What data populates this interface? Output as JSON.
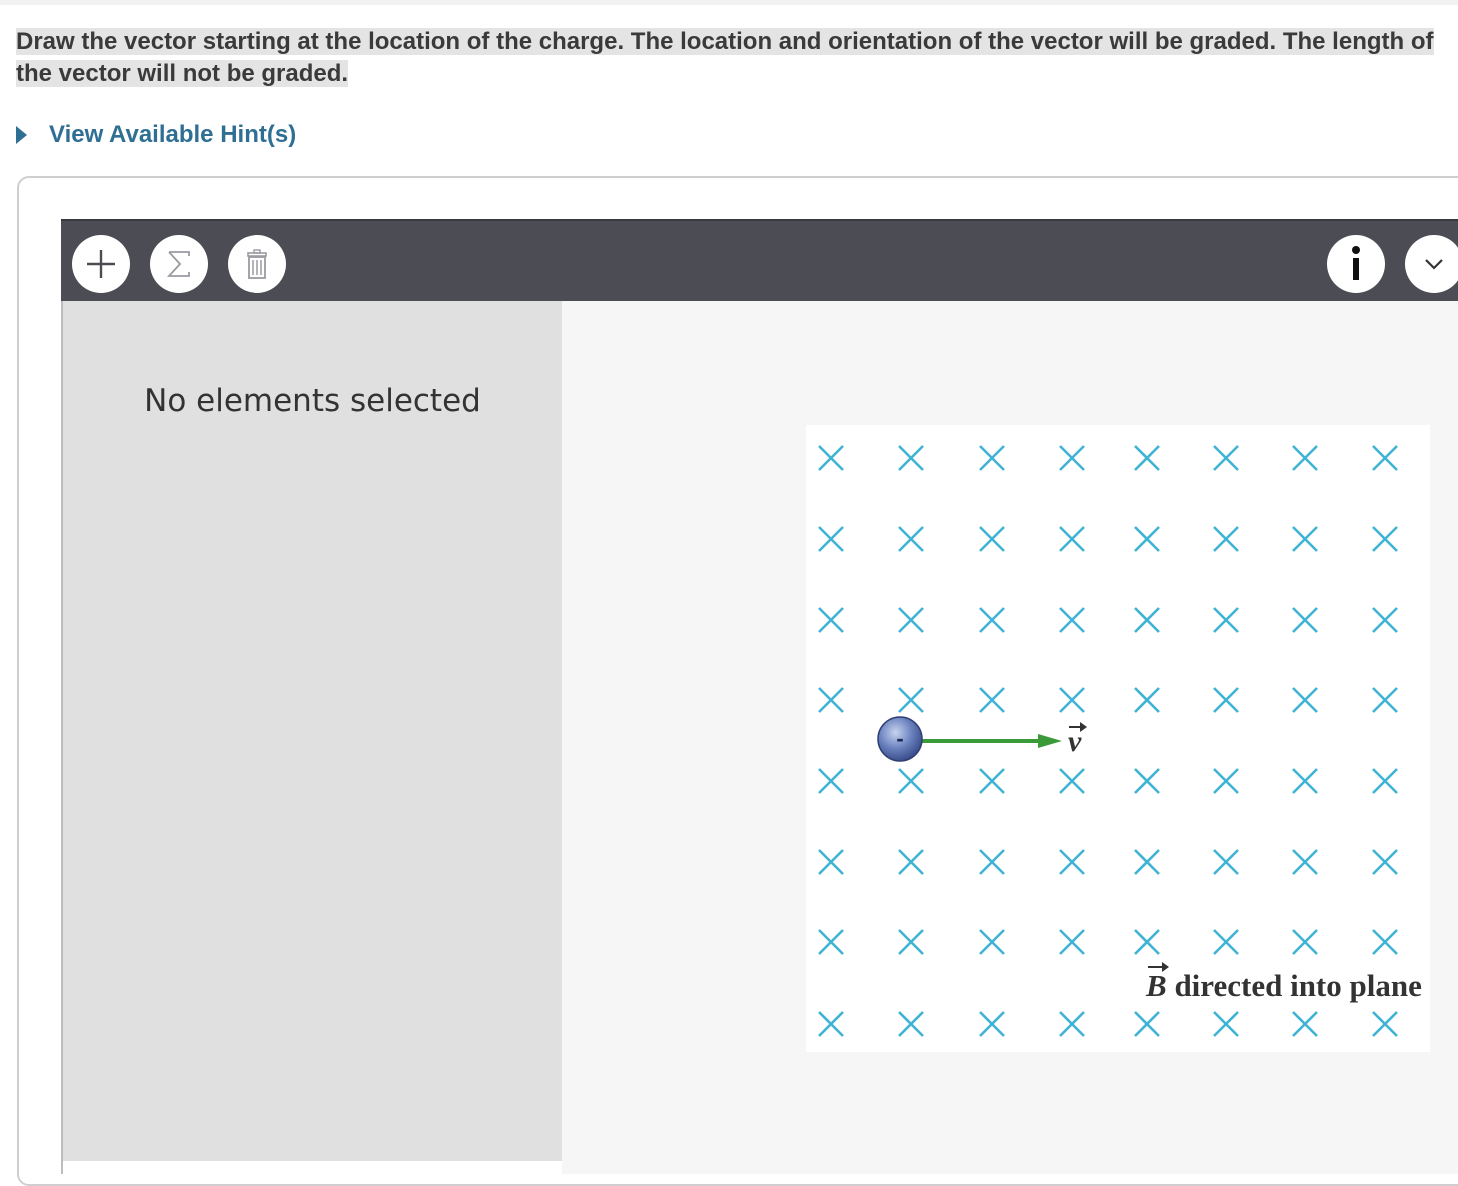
{
  "instructions": "Draw the vector starting at the location of the charge. The location and orientation of the vector will be graded. The length of the vector will not be graded.",
  "hint": {
    "label": "View Available Hint(s)"
  },
  "toolbar": {
    "add_icon": "plus-icon",
    "sum_icon": "sigma-icon",
    "delete_icon": "trash-icon",
    "info_icon": "info-icon",
    "menu_icon": "chevron-down-icon"
  },
  "side_panel": {
    "message": "No elements selected"
  },
  "figure": {
    "charge_label": "-",
    "velocity_label": "v",
    "field_caption_symbol": "B",
    "field_caption_text": " directed into plane",
    "field_mark_color": "#3fb3d4",
    "velocity_color": "#3a9a3a",
    "charge_color": "#4a63a8"
  }
}
